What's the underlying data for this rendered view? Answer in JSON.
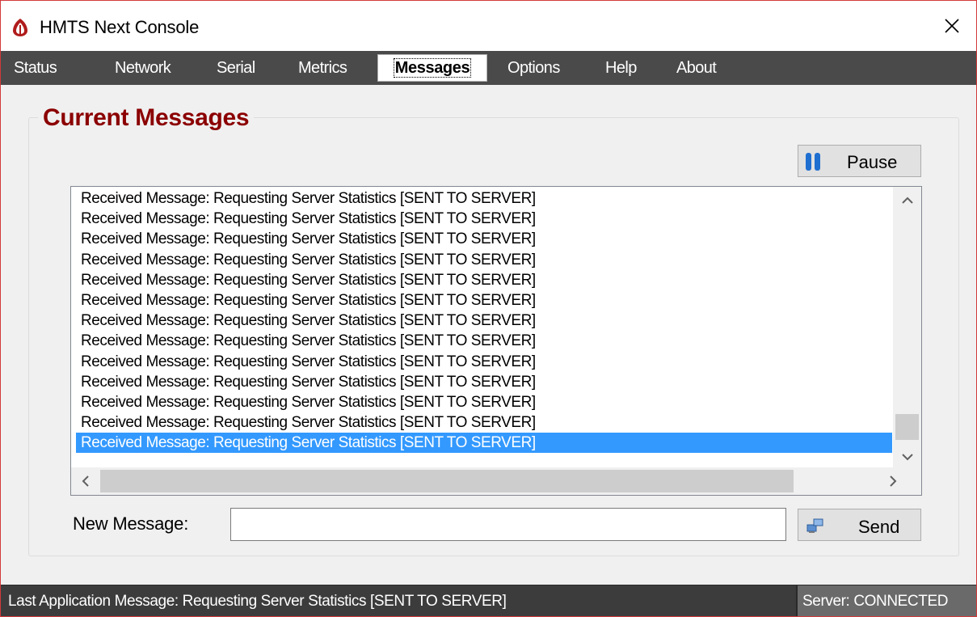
{
  "window": {
    "title": "HMTS Next Console"
  },
  "menu": {
    "items": [
      {
        "label": "Status"
      },
      {
        "label": "Network"
      },
      {
        "label": "Serial"
      },
      {
        "label": "Metrics"
      },
      {
        "label": "Messages",
        "active": true
      },
      {
        "label": "Options"
      },
      {
        "label": "Help"
      },
      {
        "label": "About"
      }
    ]
  },
  "main": {
    "section_title": "Current Messages",
    "pause_label": "Pause",
    "messages": [
      "Received Message: Requesting Server Statistics [SENT TO SERVER]",
      "Received Message: Requesting Server Statistics [SENT TO SERVER]",
      "Received Message: Requesting Server Statistics [SENT TO SERVER]",
      "Received Message: Requesting Server Statistics [SENT TO SERVER]",
      "Received Message: Requesting Server Statistics [SENT TO SERVER]",
      "Received Message: Requesting Server Statistics [SENT TO SERVER]",
      "Received Message: Requesting Server Statistics [SENT TO SERVER]",
      "Received Message: Requesting Server Statistics [SENT TO SERVER]",
      "Received Message: Requesting Server Statistics [SENT TO SERVER]",
      "Received Message: Requesting Server Statistics [SENT TO SERVER]",
      "Received Message: Requesting Server Statistics [SENT TO SERVER]",
      "Received Message: Requesting Server Statistics [SENT TO SERVER]",
      "Received Message: Requesting Server Statistics [SENT TO SERVER]"
    ],
    "selected_index": 12,
    "new_message_label": "New Message:",
    "new_message_value": "",
    "send_label": "Send"
  },
  "statusbar": {
    "last_message": "Last Application Message:  Requesting Server Statistics [SENT TO SERVER]",
    "server_status": "Server:  CONNECTED"
  },
  "colors": {
    "accent": "#8b0000",
    "menu_bg": "#4a4a4a",
    "selection": "#3399ff",
    "status_bg": "#3c3c3c"
  },
  "icons": {
    "app": "app-logo-icon",
    "close": "close-icon",
    "pause": "pause-icon",
    "send": "network-send-icon"
  }
}
